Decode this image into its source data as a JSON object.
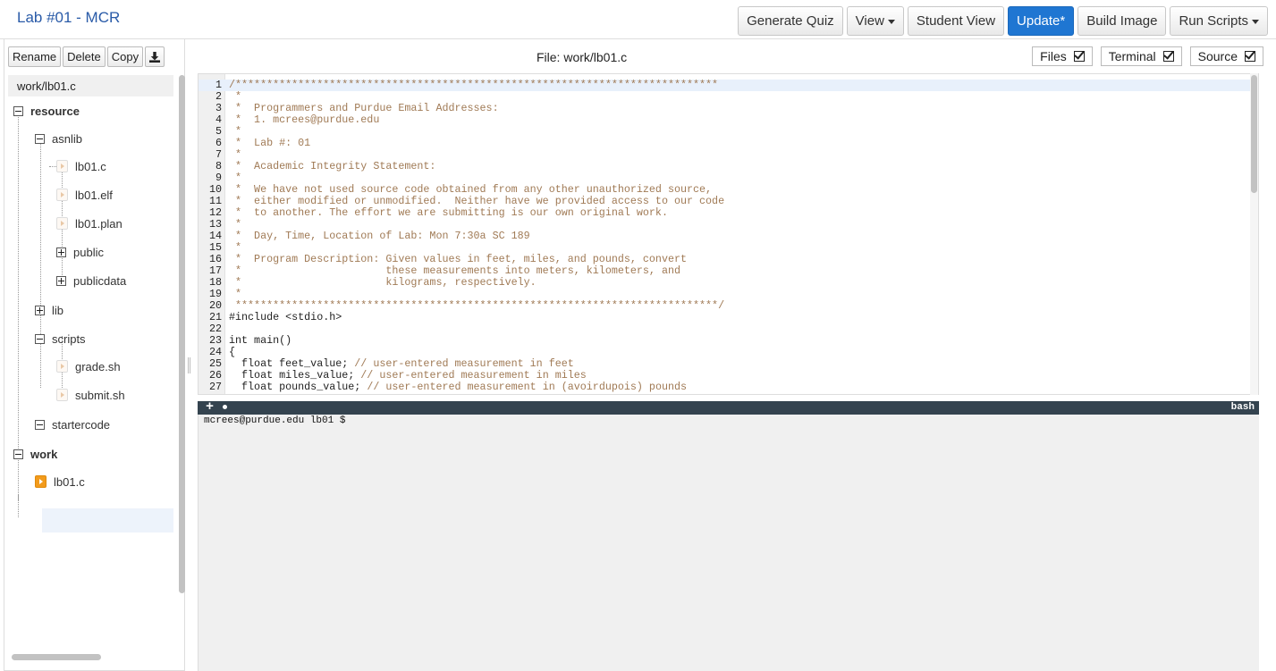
{
  "app": {
    "title": "Lab #01 - MCR"
  },
  "toolbar": {
    "generate_quiz": "Generate Quiz",
    "view": "View",
    "student_view": "Student View",
    "update": "Update*",
    "build_image": "Build Image",
    "run_scripts": "Run Scripts"
  },
  "file_actions": {
    "rename": "Rename",
    "delete": "Delete",
    "copy": "Copy",
    "download_icon": "download-icon"
  },
  "file_title": "File: work/lb01.c",
  "toggles": {
    "files": "Files",
    "terminal": "Terminal",
    "source": "Source"
  },
  "tree": {
    "header": "work/lb01.c",
    "resource": "resource",
    "asnlib": "asnlib",
    "asnlib_files": [
      "lb01.c",
      "lb01.elf",
      "lb01.plan"
    ],
    "public": "public",
    "publicdata": "publicdata",
    "lib": "lib",
    "scripts": "scripts",
    "scripts_files": [
      "grade.sh",
      "submit.sh"
    ],
    "startercode": "startercode",
    "work": "work",
    "work_file": "lb01.c"
  },
  "editor": {
    "lines": [
      "/*****************************************************************************",
      " *",
      " *  Programmers and Purdue Email Addresses:",
      " *  1. mcrees@purdue.edu",
      " *",
      " *  Lab #: 01",
      " *",
      " *  Academic Integrity Statement:",
      " *",
      " *  We have not used source code obtained from any other unauthorized source,",
      " *  either modified or unmodified.  Neither have we provided access to our code",
      " *  to another. The effort we are submitting is our own original work.",
      " *",
      " *  Day, Time, Location of Lab: Mon 7:30a SC 189",
      " *",
      " *  Program Description: Given values in feet, miles, and pounds, convert",
      " *                       these measurements into meters, kilometers, and",
      " *                       kilograms, respectively.",
      " *",
      " *****************************************************************************/",
      "#include <stdio.h>",
      "",
      "int main()",
      "{",
      "  float feet_value; // user-entered measurement in feet",
      "  float miles_value; // user-entered measurement in miles",
      "  float pounds_value; // user-entered measurement in (avoirdupois) pounds"
    ]
  },
  "terminal": {
    "shell": "bash",
    "prompt": "mcrees@purdue.edu lb01 $ ",
    "add_label": "+"
  }
}
